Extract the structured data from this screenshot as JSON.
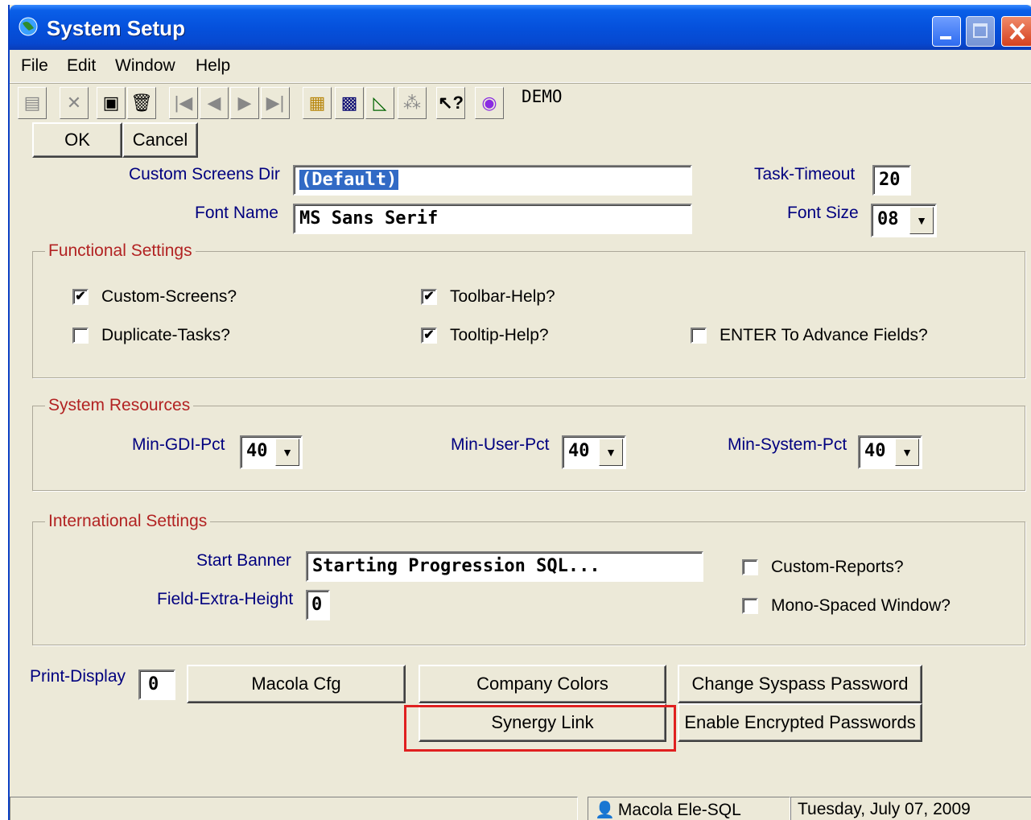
{
  "window": {
    "title": "System Setup"
  },
  "menu": [
    "File",
    "Edit",
    "Window",
    "Help"
  ],
  "toolbar": {
    "icons": [
      "add-record-icon",
      "delete-record-icon",
      "save-icon",
      "trash-icon",
      "first-record-icon",
      "prev-record-icon",
      "next-record-icon",
      "last-record-icon",
      "notes-icon",
      "calculator-icon",
      "chart-icon",
      "network-icon",
      "context-help-icon",
      "globe-icon"
    ],
    "company": "DEMO"
  },
  "actions": {
    "ok": "OK",
    "cancel": "Cancel"
  },
  "fields": {
    "custom_screens_dir_label": "Custom Screens Dir",
    "custom_screens_dir_value": "(Default)",
    "font_name_label": "Font Name",
    "font_name_value": "MS Sans Serif",
    "task_timeout_label": "Task-Timeout",
    "task_timeout_value": "20",
    "font_size_label": "Font Size",
    "font_size_value": "08"
  },
  "functional": {
    "title": "Functional Settings",
    "custom_screens": {
      "label": "Custom-Screens?",
      "checked": true
    },
    "duplicate_tasks": {
      "label": "Duplicate-Tasks?",
      "checked": false
    },
    "toolbar_help": {
      "label": "Toolbar-Help?",
      "checked": true
    },
    "tooltip_help": {
      "label": "Tooltip-Help?",
      "checked": true
    },
    "enter_advance": {
      "label": "ENTER To Advance Fields?",
      "checked": false
    }
  },
  "resources": {
    "title": "System Resources",
    "gdi_label": "Min-GDI-Pct",
    "gdi_value": "40",
    "user_label": "Min-User-Pct",
    "user_value": "40",
    "system_label": "Min-System-Pct",
    "system_value": "40"
  },
  "international": {
    "title": "International Settings",
    "banner_label": "Start Banner",
    "banner_value": "Starting Progression SQL...",
    "extra_height_label": "Field-Extra-Height",
    "extra_height_value": "0",
    "custom_reports": {
      "label": "Custom-Reports?",
      "checked": false
    },
    "mono_spaced": {
      "label": "Mono-Spaced Window?",
      "checked": false
    }
  },
  "bottom": {
    "print_display_label": "Print-Display",
    "print_display_value": "0",
    "macola_cfg": "Macola Cfg",
    "company_colors": "Company Colors",
    "change_password": "Change Syspass Password",
    "synergy_link": "Synergy Link",
    "enable_encrypted": "Enable Encrypted Passwords"
  },
  "status": {
    "left": "",
    "connection": "Macola Ele-SQL",
    "date": "Tuesday, July 07, 2009"
  }
}
